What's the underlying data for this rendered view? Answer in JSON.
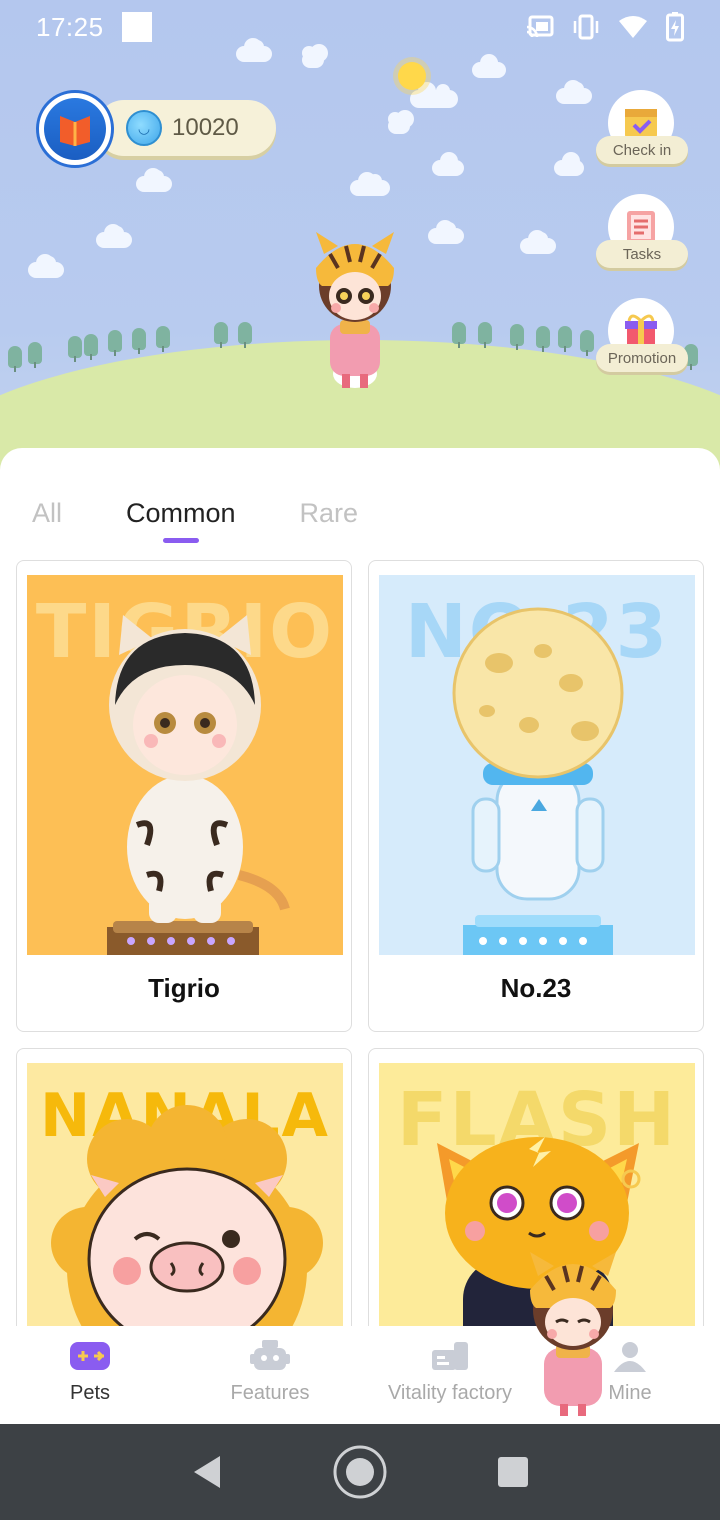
{
  "status_bar": {
    "time": "17:25"
  },
  "header": {
    "coin_balance": "10020"
  },
  "side_buttons": [
    {
      "label": "Check in"
    },
    {
      "label": "Tasks"
    },
    {
      "label": "Promotion"
    }
  ],
  "tabs": [
    {
      "label": "All",
      "active": false
    },
    {
      "label": "Common",
      "active": true
    },
    {
      "label": "Rare",
      "active": false
    }
  ],
  "pets": [
    {
      "name": "Tigrio",
      "poster_word": "TIGRIO",
      "bg": "#fdbf55",
      "word_color": "#fdd98a"
    },
    {
      "name": "No.23",
      "poster_word": "NO.23",
      "bg": "#d6ebfb",
      "word_color": "#a7d7f7"
    },
    {
      "name": "",
      "poster_word": "NANALA",
      "bg": "#fde9a1",
      "word_color": "#f6b90b"
    },
    {
      "name": "",
      "poster_word": "FLASH",
      "bg": "#fdeb9a",
      "word_color": "#f4d96a"
    }
  ],
  "bottom_nav": [
    {
      "label": "Pets",
      "icon": "gamepad-icon",
      "active": true
    },
    {
      "label": "Features",
      "icon": "robot-icon",
      "active": false
    },
    {
      "label": "Vitality factory",
      "icon": "factory-icon",
      "active": false
    },
    {
      "label": "Mine",
      "icon": "person-icon",
      "active": false
    }
  ],
  "colors": {
    "accent": "#8a5cf0",
    "sky": "#b4c7ee",
    "hill": "#d9e9a8"
  }
}
